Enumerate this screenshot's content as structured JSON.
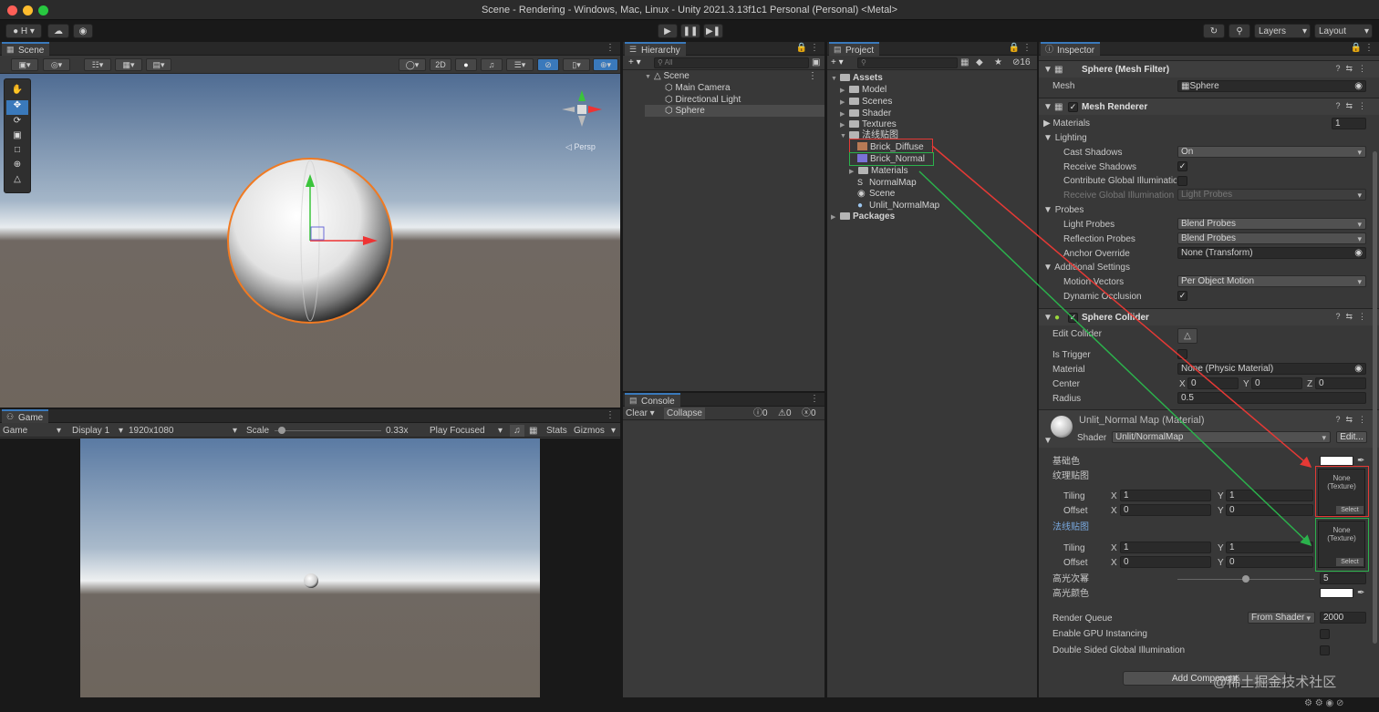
{
  "window": {
    "title": "Scene - Rendering - Windows, Mac, Linux - Unity 2021.3.13f1c1 Personal (Personal) <Metal>"
  },
  "toolbar": {
    "account": "H",
    "layers": "Layers",
    "layout": "Layout"
  },
  "scene": {
    "tab": "Scene",
    "btn_2d": "2D",
    "persp": "◁ Persp"
  },
  "game": {
    "tab": "Game",
    "view": "Game",
    "display": "Display 1",
    "resolution": "1920x1080",
    "scale_label": "Scale",
    "scale_value": "0.33x",
    "scale_fraction": 0.05,
    "play_mode": "Play Focused",
    "stats": "Stats",
    "gizmos": "Gizmos"
  },
  "hierarchy": {
    "tab": "Hierarchy",
    "search_placeholder": "All",
    "scene": "Scene",
    "items": [
      "Main Camera",
      "Directional Light",
      "Sphere"
    ]
  },
  "console": {
    "tab": "Console",
    "clear": "Clear",
    "collapse": "Collapse",
    "info_count": "0",
    "warn_count": "0",
    "error_count": "0"
  },
  "project": {
    "tab": "Project",
    "count": "16",
    "root": "Assets",
    "folders": [
      "Model",
      "Scenes",
      "Shader",
      "Textures"
    ],
    "open_folder": "法线贴图",
    "files": [
      "Brick_Diffuse",
      "Brick_Normal",
      "Materials",
      "NormalMap",
      "Scene",
      "Unlit_NormalMap"
    ],
    "packages": "Packages"
  },
  "inspector": {
    "tab": "Inspector",
    "mesh_filter": {
      "title": "Sphere (Mesh Filter)",
      "mesh_label": "Mesh",
      "mesh_value": "Sphere"
    },
    "mesh_renderer": {
      "title": "Mesh Renderer",
      "materials_label": "Materials",
      "materials_value": "1",
      "lighting_label": "Lighting",
      "cast_shadows_label": "Cast Shadows",
      "cast_shadows_value": "On",
      "receive_shadows_label": "Receive Shadows",
      "contribute_gi_label": "Contribute Global Illuminatio",
      "receive_gi_label": "Receive Global Illumination",
      "receive_gi_value": "Light Probes",
      "probes_label": "Probes",
      "light_probes_label": "Light Probes",
      "light_probes_value": "Blend Probes",
      "reflection_probes_label": "Reflection Probes",
      "reflection_probes_value": "Blend Probes",
      "anchor_label": "Anchor Override",
      "anchor_value": "None (Transform)",
      "additional_label": "Additional Settings",
      "motion_label": "Motion Vectors",
      "motion_value": "Per Object Motion",
      "dynamic_occlusion_label": "Dynamic Occlusion"
    },
    "sphere_collider": {
      "title": "Sphere Collider",
      "edit_label": "Edit Collider",
      "trigger_label": "Is Trigger",
      "material_label": "Material",
      "material_value": "None (Physic Material)",
      "center_label": "Center",
      "cx": "0",
      "cy": "0",
      "cz": "0",
      "radius_label": "Radius",
      "radius_value": "0.5"
    },
    "material": {
      "title": "Unlit_Normal Map (Material)",
      "shader_label": "Shader",
      "shader_value": "Unlit/NormalMap",
      "edit_btn": "Edit...",
      "base_color_label": "基础色",
      "texture_label": "纹理贴图",
      "tiling_label": "Tiling",
      "offset_label": "Offset",
      "tex_tiling_x": "1",
      "tex_tiling_y": "1",
      "tex_offset_x": "0",
      "tex_offset_y": "0",
      "normal_label": "法线贴图",
      "nrm_tiling_x": "1",
      "nrm_tiling_y": "1",
      "nrm_offset_x": "0",
      "nrm_offset_y": "0",
      "slot_text": "None\n(Texture)",
      "select": "Select",
      "gloss_label": "高光次幂",
      "gloss_value": "5",
      "gloss_fraction": 0.5,
      "spec_color_label": "高光颜色",
      "render_queue_label": "Render Queue",
      "render_queue_mode": "From Shader",
      "render_queue_value": "2000",
      "gpu_label": "Enable GPU Instancing",
      "double_sided_label": "Double Sided Global Illumination",
      "add_component": "Add Component"
    }
  },
  "watermark": "@稀土掘金技术社区",
  "colors": {
    "accent": "#3a79bb",
    "red_annotation": "#e53935",
    "green_annotation": "#2bb24c",
    "selection": "#2c5d87"
  }
}
